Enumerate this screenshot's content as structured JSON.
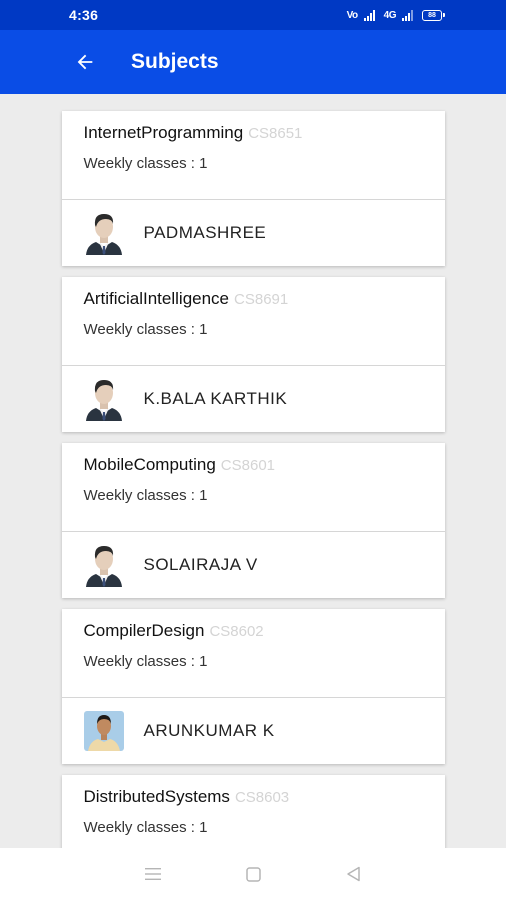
{
  "status_bar": {
    "time": "4:36",
    "signal1": "Vo",
    "signal2": "4G",
    "battery": "88"
  },
  "app_bar": {
    "title": "Subjects",
    "back_icon": "arrow-left-icon",
    "color": "#0a4de6"
  },
  "subjects": [
    {
      "name": "InternetProgramming",
      "code": "CS8651",
      "weekly": "Weekly classes : 1",
      "teacher": "PADMASHREE",
      "avatar": "male-avatar-icon"
    },
    {
      "name": "ArtificialIntelligence",
      "code": "CS8691",
      "weekly": "Weekly classes : 1",
      "teacher": "K.BALA KARTHIK",
      "avatar": "male-avatar-icon"
    },
    {
      "name": "MobileComputing",
      "code": "CS8601",
      "weekly": "Weekly classes : 1",
      "teacher": "SOLAIRAJA V",
      "avatar": "male-avatar-icon"
    },
    {
      "name": "CompilerDesign",
      "code": "CS8602",
      "weekly": "Weekly classes : 1",
      "teacher": "ARUNKUMAR K",
      "avatar": "photo-avatar"
    },
    {
      "name": "DistributedSystems",
      "code": "CS8603",
      "weekly": "Weekly classes : 1"
    }
  ],
  "nav": {
    "recents_icon": "menu-icon",
    "home_icon": "square-home-icon",
    "back_icon": "triangle-back-icon"
  }
}
